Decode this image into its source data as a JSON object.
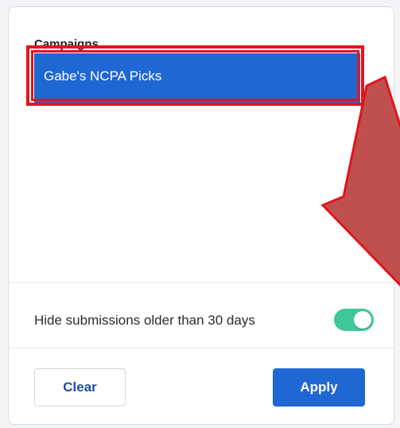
{
  "campaigns": {
    "label": "Campaigns",
    "items": [
      {
        "label": "Gabe's NCPA Picks",
        "selected": true
      }
    ]
  },
  "filter": {
    "hide_label": "Hide submissions older than 30 days",
    "hide_enabled": true
  },
  "buttons": {
    "clear_label": "Clear",
    "apply_label": "Apply"
  },
  "colors": {
    "accent": "#1f67d2",
    "toggle_on": "#3ec79a",
    "annotation_red": "#e3141c",
    "annotation_arrow_fill": "#c0504d"
  }
}
